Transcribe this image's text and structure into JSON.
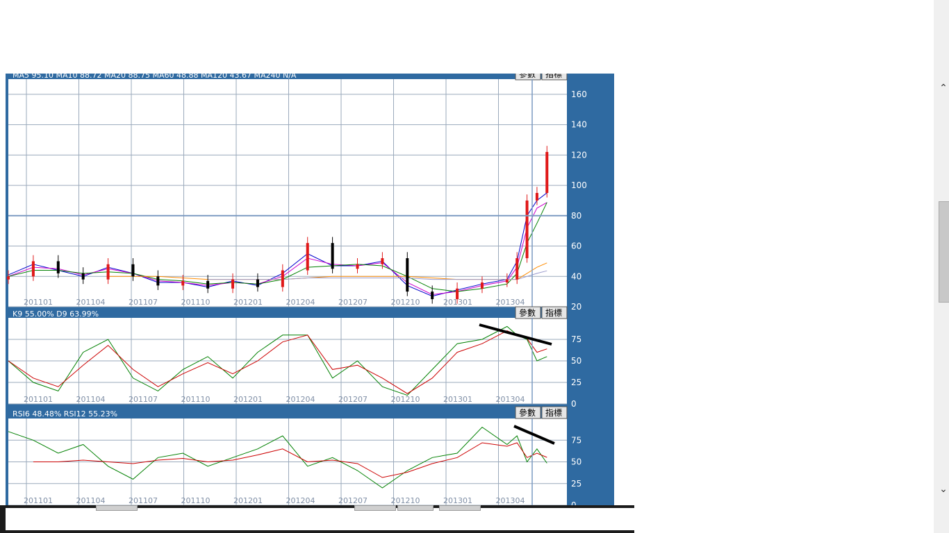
{
  "main_panel": {
    "ma_legend": "MA5 95.10   MA10 88.72   MA20 88.75   MA60 48.88   MA120 43.67   MA240 N/A",
    "buttons": {
      "param": "參數",
      "indicator": "指標"
    },
    "yticks": [
      "160",
      "140",
      "120",
      "100",
      "80",
      "60",
      "40",
      "20"
    ]
  },
  "kd_panel": {
    "legend": "K9 55.00%  D9 63.99%",
    "buttons": {
      "param": "參數",
      "indicator": "指標"
    },
    "yticks": [
      "75",
      "50",
      "25",
      "0"
    ]
  },
  "rsi_panel": {
    "legend": "RSI6 48.48%  RSI12 55.23%",
    "buttons": {
      "param": "參數",
      "indicator": "指標"
    },
    "yticks": [
      "75",
      "50",
      "25",
      "0"
    ]
  },
  "xticks": [
    "201101",
    "201104",
    "201107",
    "201110",
    "201201",
    "201204",
    "201207",
    "201210",
    "201301",
    "201304"
  ],
  "colors": {
    "frame": "#2f6aa1",
    "up": "#e01818",
    "down": "#000000",
    "ma5": "#0000cc",
    "ma10": "#cc00cc",
    "ma20": "#008000",
    "ma60": "#ff8c00",
    "ma120": "#9999cc",
    "k": "#008000",
    "d": "#cc0000"
  },
  "chart_data": [
    {
      "type": "line",
      "title": "",
      "note": "weekly candlesticks with moving averages (approximate values)",
      "ylim": [
        20,
        170
      ],
      "x": [
        0,
        5,
        10,
        15,
        20,
        25,
        30,
        35,
        40,
        45,
        50,
        55,
        60,
        65,
        70,
        75,
        80,
        85,
        90,
        95,
        100,
        102,
        104,
        106,
        108
      ],
      "series": [
        {
          "name": "close",
          "values": [
            40,
            50,
            42,
            38,
            48,
            40,
            34,
            37,
            32,
            38,
            33,
            44,
            62,
            45,
            48,
            52,
            30,
            25,
            32,
            36,
            38,
            52,
            90,
            95,
            122
          ]
        },
        {
          "name": "MA5",
          "values": [
            41,
            48,
            44,
            40,
            46,
            42,
            36,
            36,
            33,
            37,
            34,
            42,
            55,
            47,
            47,
            50,
            34,
            27,
            31,
            35,
            38,
            50,
            80,
            90,
            95.1
          ]
        },
        {
          "name": "MA10",
          "values": [
            40,
            46,
            45,
            41,
            45,
            42,
            37,
            36,
            34,
            36,
            35,
            40,
            52,
            48,
            47,
            49,
            36,
            28,
            30,
            34,
            37,
            46,
            72,
            85,
            88.72
          ]
        },
        {
          "name": "MA20",
          "values": [
            40,
            44,
            44,
            42,
            43,
            42,
            38,
            37,
            35,
            36,
            35,
            38,
            46,
            47,
            48,
            47,
            40,
            32,
            30,
            32,
            35,
            42,
            62,
            75,
            88.75
          ]
        },
        {
          "name": "MA60",
          "values": [
            null,
            null,
            null,
            null,
            40,
            40,
            40,
            39,
            38,
            38,
            38,
            38,
            39,
            40,
            40,
            40,
            40,
            39,
            38,
            38,
            38,
            38,
            42,
            46,
            48.88
          ]
        },
        {
          "name": "MA120",
          "values": [
            null,
            null,
            null,
            null,
            null,
            null,
            null,
            null,
            38,
            38,
            38,
            38,
            39,
            39,
            39,
            39,
            39,
            38,
            38,
            38,
            38,
            38,
            40,
            42,
            43.67
          ]
        }
      ]
    },
    {
      "type": "line",
      "title": "",
      "ylim": [
        0,
        100
      ],
      "x": [
        0,
        5,
        10,
        15,
        20,
        25,
        30,
        35,
        40,
        45,
        50,
        55,
        60,
        65,
        70,
        75,
        80,
        85,
        90,
        95,
        100,
        102,
        104,
        106,
        108
      ],
      "series": [
        {
          "name": "K9",
          "values": [
            50,
            25,
            15,
            60,
            75,
            30,
            15,
            40,
            55,
            30,
            60,
            80,
            80,
            30,
            50,
            20,
            10,
            40,
            70,
            75,
            90,
            80,
            75,
            50,
            55
          ]
        },
        {
          "name": "D9",
          "values": [
            50,
            30,
            20,
            45,
            68,
            40,
            20,
            35,
            48,
            35,
            50,
            72,
            80,
            40,
            45,
            30,
            12,
            30,
            60,
            70,
            85,
            80,
            76,
            60,
            63.99
          ]
        }
      ]
    },
    {
      "type": "line",
      "title": "",
      "ylim": [
        0,
        100
      ],
      "x": [
        0,
        5,
        10,
        15,
        20,
        25,
        30,
        35,
        40,
        45,
        50,
        55,
        60,
        65,
        70,
        75,
        80,
        85,
        90,
        95,
        100,
        102,
        104,
        106,
        108
      ],
      "series": [
        {
          "name": "RSI6",
          "values": [
            85,
            75,
            60,
            70,
            45,
            30,
            55,
            60,
            45,
            55,
            65,
            80,
            45,
            55,
            40,
            20,
            40,
            55,
            60,
            90,
            70,
            80,
            50,
            65,
            48.48
          ]
        },
        {
          "name": "RSI12",
          "values": [
            null,
            50,
            50,
            52,
            50,
            48,
            52,
            54,
            50,
            52,
            58,
            65,
            50,
            52,
            48,
            32,
            38,
            48,
            55,
            72,
            68,
            72,
            55,
            60,
            55.23
          ]
        }
      ]
    }
  ]
}
